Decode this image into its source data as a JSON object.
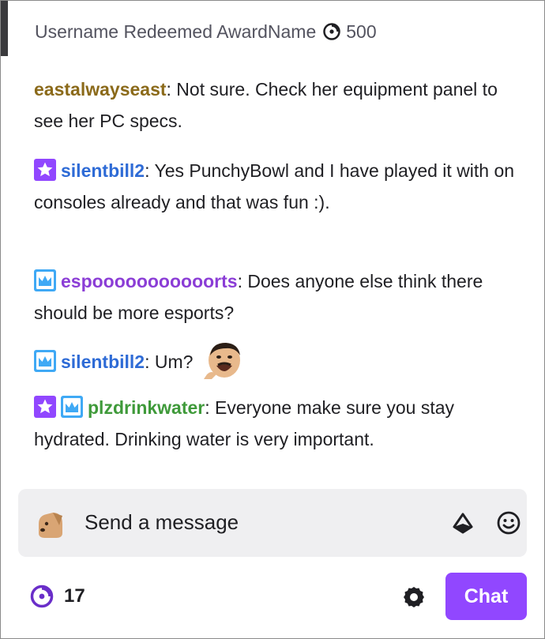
{
  "redemption": {
    "text": "Username Redeemed AwardName",
    "cost": "500"
  },
  "messages": [
    {
      "user": "eastalwayseast",
      "user_color": "#8b6a1a",
      "sep": ":",
      "text": " Not sure. Check her equipment panel to see her PC specs.",
      "badges": []
    },
    {
      "user": "silentbill2",
      "user_color": "#2e6bd6",
      "sep": ":",
      "text": " Yes PunchyBowl and I have played it with on consoles already and that was fun :).",
      "badges": [
        "subscriber-star"
      ]
    },
    {
      "user": "espooooooooooorts",
      "user_color": "#8b3dd6",
      "sep": ":",
      "text": " Does anyone else think there should be more esports?",
      "badges": [
        "prime-crown"
      ]
    },
    {
      "user": "silentbill2",
      "user_color": "#2e6bd6",
      "sep": ":",
      "text": " Um?",
      "badges": [
        "prime-crown"
      ],
      "emote": "face-emote"
    },
    {
      "user": "plzdrinkwater",
      "user_color": "#3f9a3a",
      "sep": ":",
      "text": " Everyone make sure you stay hydrated. Drinking water is very important.",
      "badges": [
        "subscriber-star",
        "prime-crown"
      ]
    }
  ],
  "input": {
    "placeholder": "Send a message",
    "avatar_icon": "dog-avatar-icon",
    "bits_icon": "bits-icon",
    "emoji_icon": "emoji-smile-icon"
  },
  "footer": {
    "points": "17",
    "settings_icon": "gear-icon",
    "chat_label": "Chat"
  },
  "colors": {
    "accent": "#9147ff",
    "badge_star": "#9147ff",
    "badge_crown": "#3fa9f5"
  }
}
